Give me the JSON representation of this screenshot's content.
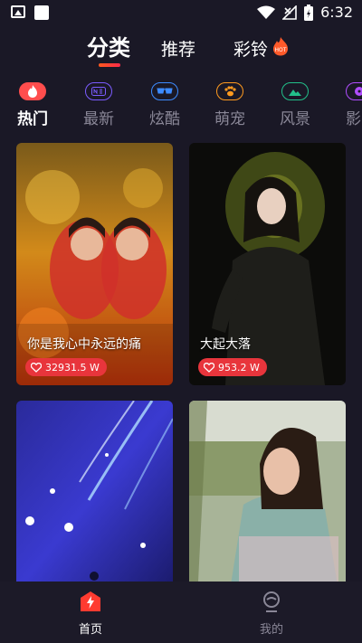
{
  "status_bar": {
    "time": "6:32"
  },
  "top_tabs": [
    {
      "label": "分类",
      "active": true
    },
    {
      "label": "推荐",
      "active": false
    },
    {
      "label": "彩铃",
      "active": false,
      "badge": "HOT"
    }
  ],
  "categories": [
    {
      "label": "热门",
      "icon": "flame-icon",
      "color": "#ff4d4d",
      "active": true
    },
    {
      "label": "最新",
      "icon": "new-icon",
      "color": "#7b5cff",
      "active": false
    },
    {
      "label": "炫酷",
      "icon": "glasses-icon",
      "color": "#3d8bff",
      "active": false
    },
    {
      "label": "萌宠",
      "icon": "paw-icon",
      "color": "#ff9a1f",
      "active": false
    },
    {
      "label": "风景",
      "icon": "landscape-icon",
      "color": "#22c08a",
      "active": false
    },
    {
      "label": "影",
      "icon": "film-icon",
      "color": "#b04dff",
      "active": false
    }
  ],
  "cards": [
    {
      "title": "你是我心中永远的痛",
      "likes": "32931.5 W"
    },
    {
      "title": "大起大落",
      "likes": "953.2 W"
    },
    {
      "title": "",
      "likes": ""
    },
    {
      "title": "",
      "likes": ""
    }
  ],
  "bottom_nav": [
    {
      "label": "首页",
      "active": true,
      "icon": "home-bolt-icon",
      "color": "#ff3b30"
    },
    {
      "label": "我的",
      "active": false,
      "icon": "profile-icon"
    }
  ]
}
